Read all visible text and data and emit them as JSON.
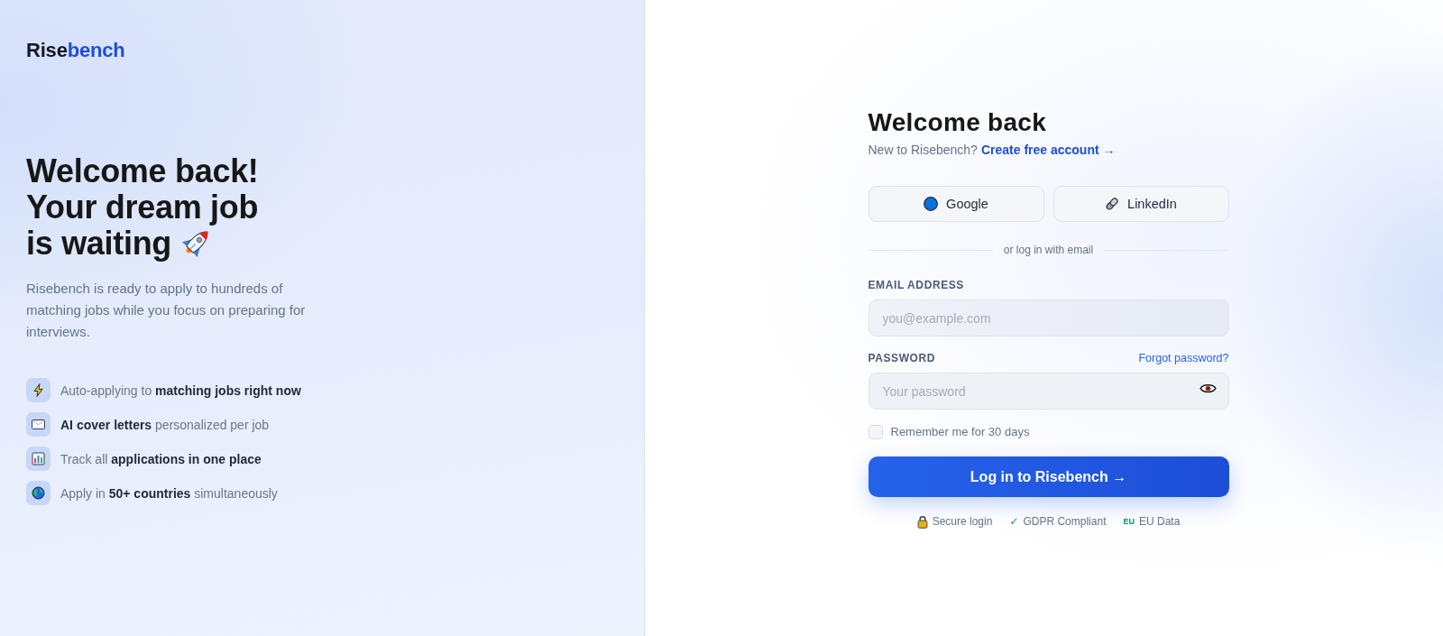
{
  "brand_panel": {
    "logo": {
      "parts": [
        {
          "text": "Rise",
          "accent": false
        },
        {
          "text": "bench",
          "accent": true
        }
      ]
    },
    "headline": [
      "Welcome back!",
      "Your dream job",
      "is waiting"
    ],
    "intro": "Risebench is ready to apply to hundreds of matching jobs while you focus on preparing for interviews.",
    "features": [
      {
        "text": "Auto-applying to **matching jobs right now**"
      },
      {
        "text": "**AI cover letters** personalized per job"
      },
      {
        "text": "Track all **applications in one place**"
      },
      {
        "text": "Apply in **50+ countries** simultaneously"
      }
    ]
  },
  "login_form": {
    "title": "Welcome back",
    "signup_prompt": "New to Risebench?",
    "signup_link": "Create free account →",
    "social_buttons": [
      {
        "label": "Google"
      },
      {
        "label": "LinkedIn"
      }
    ],
    "divider_text": "or log in with email",
    "email": {
      "label": "EMAIL ADDRESS",
      "placeholder": "you@example.com"
    },
    "password": {
      "label": "PASSWORD",
      "placeholder": "Your password",
      "forgot_link": "Forgot password?"
    },
    "remember": {
      "label": "Remember me for 30 days",
      "checked": false
    },
    "submit": "Log in to Risebench →",
    "trust": [
      {
        "kind": "lock",
        "label": "Secure login"
      },
      {
        "kind": "check",
        "mark": "✓",
        "label": "GDPR Compliant"
      },
      {
        "kind": "tag",
        "mark": "EU",
        "label": "EU Data"
      }
    ]
  }
}
